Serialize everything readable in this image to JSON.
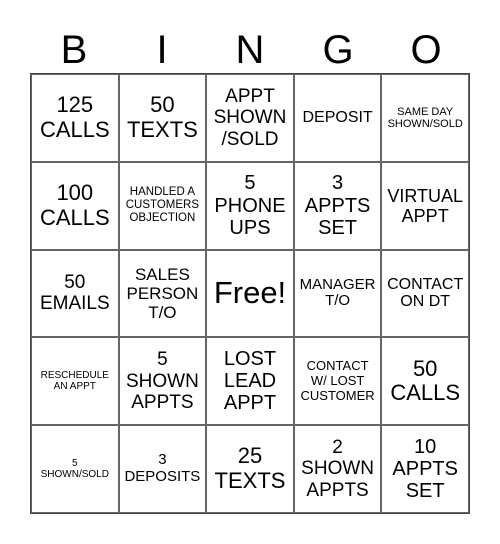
{
  "header": [
    "B",
    "I",
    "N",
    "G",
    "O"
  ],
  "cells": [
    "125\nCALLS",
    "50\nTEXTS",
    "APPT\nSHOWN\n/SOLD",
    "DEPOSIT",
    "SAME DAY\nSHOWN/SOLD",
    "100\nCALLS",
    "HANDLED A\nCUSTOMERS\nOBJECTION",
    "5\nPHONE\nUPS",
    "3\nAPPTS\nSET",
    "VIRTUAL\nAPPT",
    "50\nEMAILS",
    "SALES\nPERSON\nT/O",
    "Free!",
    "MANAGER\nT/O",
    "CONTACT\nON DT",
    "RESCHEDULE\nAN APPT",
    "5\nSHOWN\nAPPTS",
    "LOST\nLEAD\nAPPT",
    "CONTACT\nW/ LOST\nCUSTOMER",
    "50\nCALLS",
    "5\nSHOWN/SOLD",
    "3\nDEPOSITS",
    "25\nTEXTS",
    "2\nSHOWN\nAPPTS",
    "10\nAPPTS\nSET"
  ]
}
